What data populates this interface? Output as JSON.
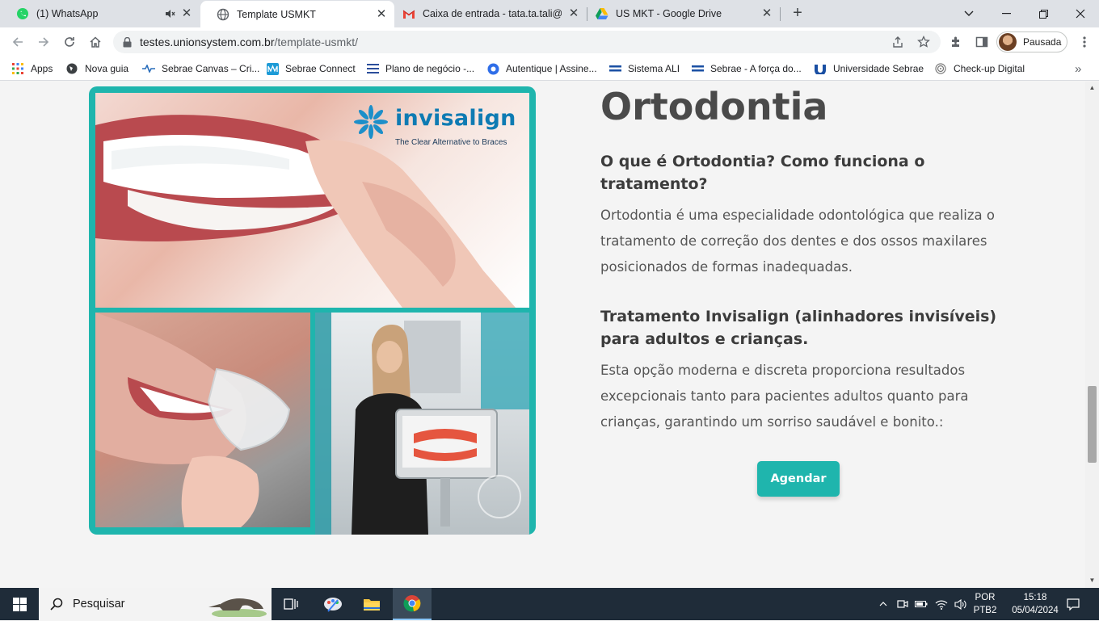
{
  "browser": {
    "tabs": [
      {
        "title": "(1) WhatsApp",
        "icon": "whatsapp-icon",
        "muted": true,
        "active": false
      },
      {
        "title": "Template USMKT",
        "icon": "globe-icon",
        "active": true
      },
      {
        "title": "Caixa de entrada - tata.ta.tali@gm",
        "icon": "gmail-icon",
        "active": false
      },
      {
        "title": "US MKT - Google Drive",
        "icon": "google-drive-icon",
        "active": false
      }
    ],
    "url_host": "testes.unionsystem.com.br",
    "url_path": "/template-usmkt/",
    "profile_label": "Pausada",
    "bookmarks": [
      {
        "label": "Apps",
        "icon": "apps-grid-icon"
      },
      {
        "label": "Nova guia",
        "icon": "globe-icon"
      },
      {
        "label": "Sebrae Canvas – Cri...",
        "icon": "sebrae-canvas-icon"
      },
      {
        "label": "Sebrae Connect",
        "icon": "sebrae-connect-icon"
      },
      {
        "label": "Plano de negócio -...",
        "icon": "document-icon"
      },
      {
        "label": "Autentique | Assine...",
        "icon": "autentique-icon"
      },
      {
        "label": "Sistema ALI",
        "icon": "sebrae-icon"
      },
      {
        "label": "Sebrae - A força do...",
        "icon": "sebrae-icon"
      },
      {
        "label": "Universidade Sebrae",
        "icon": "universidade-icon"
      },
      {
        "label": "Check-up Digital",
        "icon": "fingerprint-icon"
      }
    ]
  },
  "page": {
    "heading": "Ortodontia",
    "section1_title": "O que é Ortodontia? Como funciona o tratamento?",
    "section1_text": "Ortodontia é uma especialidade odontológica que realiza o tratamento de correção dos dentes e dos ossos maxilares posicionados de formas inadequadas.",
    "section2_title": "Tratamento Invisalign (alinhadores invisíveis) para adultos e crianças.",
    "section2_text": "Esta opção moderna e discreta proporciona resultados excepcionais tanto para pacientes adultos quanto para crianças, garantindo um sorriso saudável e bonito.:",
    "cta_label": "Agendar",
    "invisalign_brand": "invisalign",
    "invisalign_tagline": "The Clear Alternative to Braces",
    "accent_color": "#1fb5ad"
  },
  "taskbar": {
    "search_placeholder": "Pesquisar",
    "language": "POR",
    "layout": "PTB2",
    "time": "15:18",
    "date": "05/04/2024"
  }
}
